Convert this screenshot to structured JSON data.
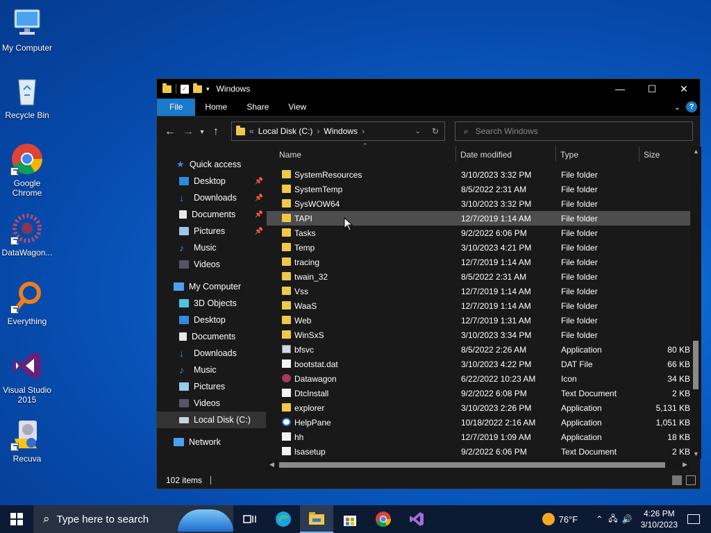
{
  "desktop": {
    "icons": [
      {
        "label": "My Computer"
      },
      {
        "label": "Recycle Bin"
      },
      {
        "label": "Google Chrome"
      },
      {
        "label": "DataWagon..."
      },
      {
        "label": "Everything"
      },
      {
        "label": "Visual Studio 2015"
      },
      {
        "label": "Recuva"
      }
    ]
  },
  "window": {
    "title": "Windows",
    "controls": {
      "minimize": "—",
      "maximize": "☐",
      "close": "✕"
    },
    "ribbon": {
      "tabs": [
        "File",
        "Home",
        "Share",
        "View"
      ]
    },
    "address": {
      "prefix": "«",
      "crumbs": [
        "Local Disk (C:)",
        "Windows"
      ]
    },
    "search_placeholder": "Search Windows",
    "navpane": {
      "quick_access": "Quick access",
      "quick_items": [
        "Desktop",
        "Downloads",
        "Documents",
        "Pictures",
        "Music",
        "Videos"
      ],
      "my_computer": "My Computer",
      "computer_items": [
        "3D Objects",
        "Desktop",
        "Documents",
        "Downloads",
        "Music",
        "Pictures",
        "Videos",
        "Local Disk (C:)"
      ],
      "network": "Network"
    },
    "columns": {
      "name": "Name",
      "date": "Date modified",
      "type": "Type",
      "size": "Size"
    },
    "rows": [
      {
        "name": "SystemResources",
        "date": "3/10/2023 3:32 PM",
        "type": "File folder",
        "size": "",
        "icon": "folder"
      },
      {
        "name": "SystemTemp",
        "date": "8/5/2022 2:31 AM",
        "type": "File folder",
        "size": "",
        "icon": "folder"
      },
      {
        "name": "SysWOW64",
        "date": "3/10/2023 3:32 PM",
        "type": "File folder",
        "size": "",
        "icon": "folder"
      },
      {
        "name": "TAPI",
        "date": "12/7/2019 1:14 AM",
        "type": "File folder",
        "size": "",
        "icon": "folder"
      },
      {
        "name": "Tasks",
        "date": "9/2/2022 6:06 PM",
        "type": "File folder",
        "size": "",
        "icon": "folder"
      },
      {
        "name": "Temp",
        "date": "3/10/2023 4:21 PM",
        "type": "File folder",
        "size": "",
        "icon": "folder"
      },
      {
        "name": "tracing",
        "date": "12/7/2019 1:14 AM",
        "type": "File folder",
        "size": "",
        "icon": "folder"
      },
      {
        "name": "twain_32",
        "date": "8/5/2022 2:31 AM",
        "type": "File folder",
        "size": "",
        "icon": "folder"
      },
      {
        "name": "Vss",
        "date": "12/7/2019 1:14 AM",
        "type": "File folder",
        "size": "",
        "icon": "folder"
      },
      {
        "name": "WaaS",
        "date": "12/7/2019 1:14 AM",
        "type": "File folder",
        "size": "",
        "icon": "folder"
      },
      {
        "name": "Web",
        "date": "12/7/2019 1:31 AM",
        "type": "File folder",
        "size": "",
        "icon": "folder"
      },
      {
        "name": "WinSxS",
        "date": "3/10/2023 3:34 PM",
        "type": "File folder",
        "size": "",
        "icon": "folder"
      },
      {
        "name": "bfsvc",
        "date": "8/5/2022 2:26 AM",
        "type": "Application",
        "size": "80 KB",
        "icon": "app"
      },
      {
        "name": "bootstat.dat",
        "date": "3/10/2023 4:22 PM",
        "type": "DAT File",
        "size": "66 KB",
        "icon": "file"
      },
      {
        "name": "Datawagon",
        "date": "6/22/2022 10:23 AM",
        "type": "Icon",
        "size": "34 KB",
        "icon": "datawagon"
      },
      {
        "name": "DtcInstall",
        "date": "9/2/2022 6:08 PM",
        "type": "Text Document",
        "size": "2 KB",
        "icon": "file"
      },
      {
        "name": "explorer",
        "date": "3/10/2023 2:26 PM",
        "type": "Application",
        "size": "5,131 KB",
        "icon": "explorer"
      },
      {
        "name": "HelpPane",
        "date": "10/18/2022 2:16 AM",
        "type": "Application",
        "size": "1,051 KB",
        "icon": "help"
      },
      {
        "name": "hh",
        "date": "12/7/2019 1:09 AM",
        "type": "Application",
        "size": "18 KB",
        "icon": "hh"
      },
      {
        "name": "lsasetup",
        "date": "9/2/2022 6:06 PM",
        "type": "Text Document",
        "size": "2 KB",
        "icon": "file"
      }
    ],
    "status": "102 items"
  },
  "taskbar": {
    "search_placeholder": "Type here to search",
    "weather": "76°F",
    "time": "4:26 PM",
    "date": "3/10/2023"
  }
}
